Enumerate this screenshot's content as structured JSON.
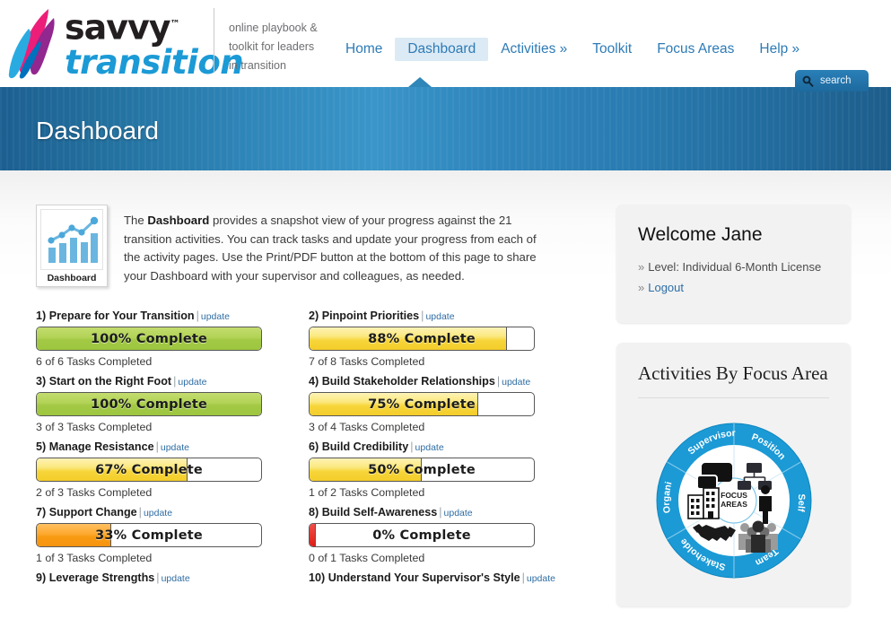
{
  "brand": {
    "name_primary": "savvy",
    "trademark": "™",
    "name_secondary": "transition",
    "tagline_line1": "online playbook &",
    "tagline_line2": "toolkit for leaders",
    "tagline_line3": "in transition",
    "logo_colors": {
      "pink": "#ec1e79",
      "purple": "#92278f",
      "blue": "#29abe2",
      "word_blue": "#1b9ad6"
    }
  },
  "nav": {
    "items": [
      {
        "label": "Home",
        "active": false
      },
      {
        "label": "Dashboard",
        "active": true
      },
      {
        "label": "Activities »",
        "active": false
      },
      {
        "label": "Toolkit",
        "active": false
      },
      {
        "label": "Focus Areas",
        "active": false
      },
      {
        "label": "Help »",
        "active": false
      }
    ]
  },
  "search": {
    "label": "search",
    "icon": "search-icon"
  },
  "banner": {
    "title": "Dashboard",
    "color_left": "#1c5f91",
    "color_right": "#3a95c9"
  },
  "intro": {
    "thumb_label": "Dashboard",
    "thumb_icon": "bar-line-chart-icon",
    "text_part1": "The ",
    "text_bold": "Dashboard",
    "text_part2": " provides a snapshot view of your progress against the 21 transition activities. You can track tasks and update your progress from each of the activity pages. Use the Print/PDF button at the bottom of this page to share your Dashboard with your supervisor and colleagues, as needed."
  },
  "progress": {
    "update_label": "update",
    "items": [
      {
        "title": "1) Prepare for Your Transition",
        "percent": 100,
        "label": "100% Complete",
        "tasks": "6 of 6 Tasks Completed",
        "color": "green"
      },
      {
        "title": "2) Pinpoint Priorities",
        "percent": 88,
        "label": "88% Complete",
        "tasks": "7 of 8 Tasks Completed",
        "color": "yellow"
      },
      {
        "title": "3) Start on the Right Foot",
        "percent": 100,
        "label": "100% Complete",
        "tasks": "3 of 3 Tasks Completed",
        "color": "green"
      },
      {
        "title": "4) Build Stakeholder Relationships",
        "percent": 75,
        "label": "75% Complete",
        "tasks": "3 of 4 Tasks Completed",
        "color": "yellow"
      },
      {
        "title": "5) Manage Resistance",
        "percent": 67,
        "label": "67% Complete",
        "tasks": "2 of 3 Tasks Completed",
        "color": "yellow"
      },
      {
        "title": "6) Build Credibility",
        "percent": 50,
        "label": "50% Complete",
        "tasks": "1 of 2 Tasks Completed",
        "color": "yellow"
      },
      {
        "title": "7) Support Change",
        "percent": 33,
        "label": "33% Complete",
        "tasks": "1 of 3 Tasks Completed",
        "color": "orange"
      },
      {
        "title": "8) Build Self-Awareness",
        "percent": 0,
        "label": "0% Complete",
        "tasks": "0 of 1 Tasks Completed",
        "color": "red"
      },
      {
        "title": "9) Leverage Strengths",
        "percent": null,
        "label": "",
        "tasks": "",
        "color": ""
      },
      {
        "title": "10) Understand Your Supervisor's Style",
        "percent": null,
        "label": "",
        "tasks": "",
        "color": ""
      }
    ]
  },
  "welcome": {
    "heading": "Welcome Jane",
    "chevron": "»",
    "level": "Level: Individual 6-Month License",
    "logout": "Logout"
  },
  "focus_area": {
    "heading": "Activities By Focus Area",
    "center_line1": "FOCUS",
    "center_line2": "AREAS",
    "ring_color": "#1b9ad6",
    "segments": [
      {
        "label": "Supervisor",
        "icon": "speech-bubbles-icon"
      },
      {
        "label": "Position",
        "icon": "org-chart-icon"
      },
      {
        "label": "Self",
        "icon": "person-icon"
      },
      {
        "label": "Team",
        "icon": "people-group-icon"
      },
      {
        "label": "Stakeholder",
        "icon": "handshake-icon"
      },
      {
        "label": "Organization",
        "icon": "building-icon"
      }
    ]
  }
}
